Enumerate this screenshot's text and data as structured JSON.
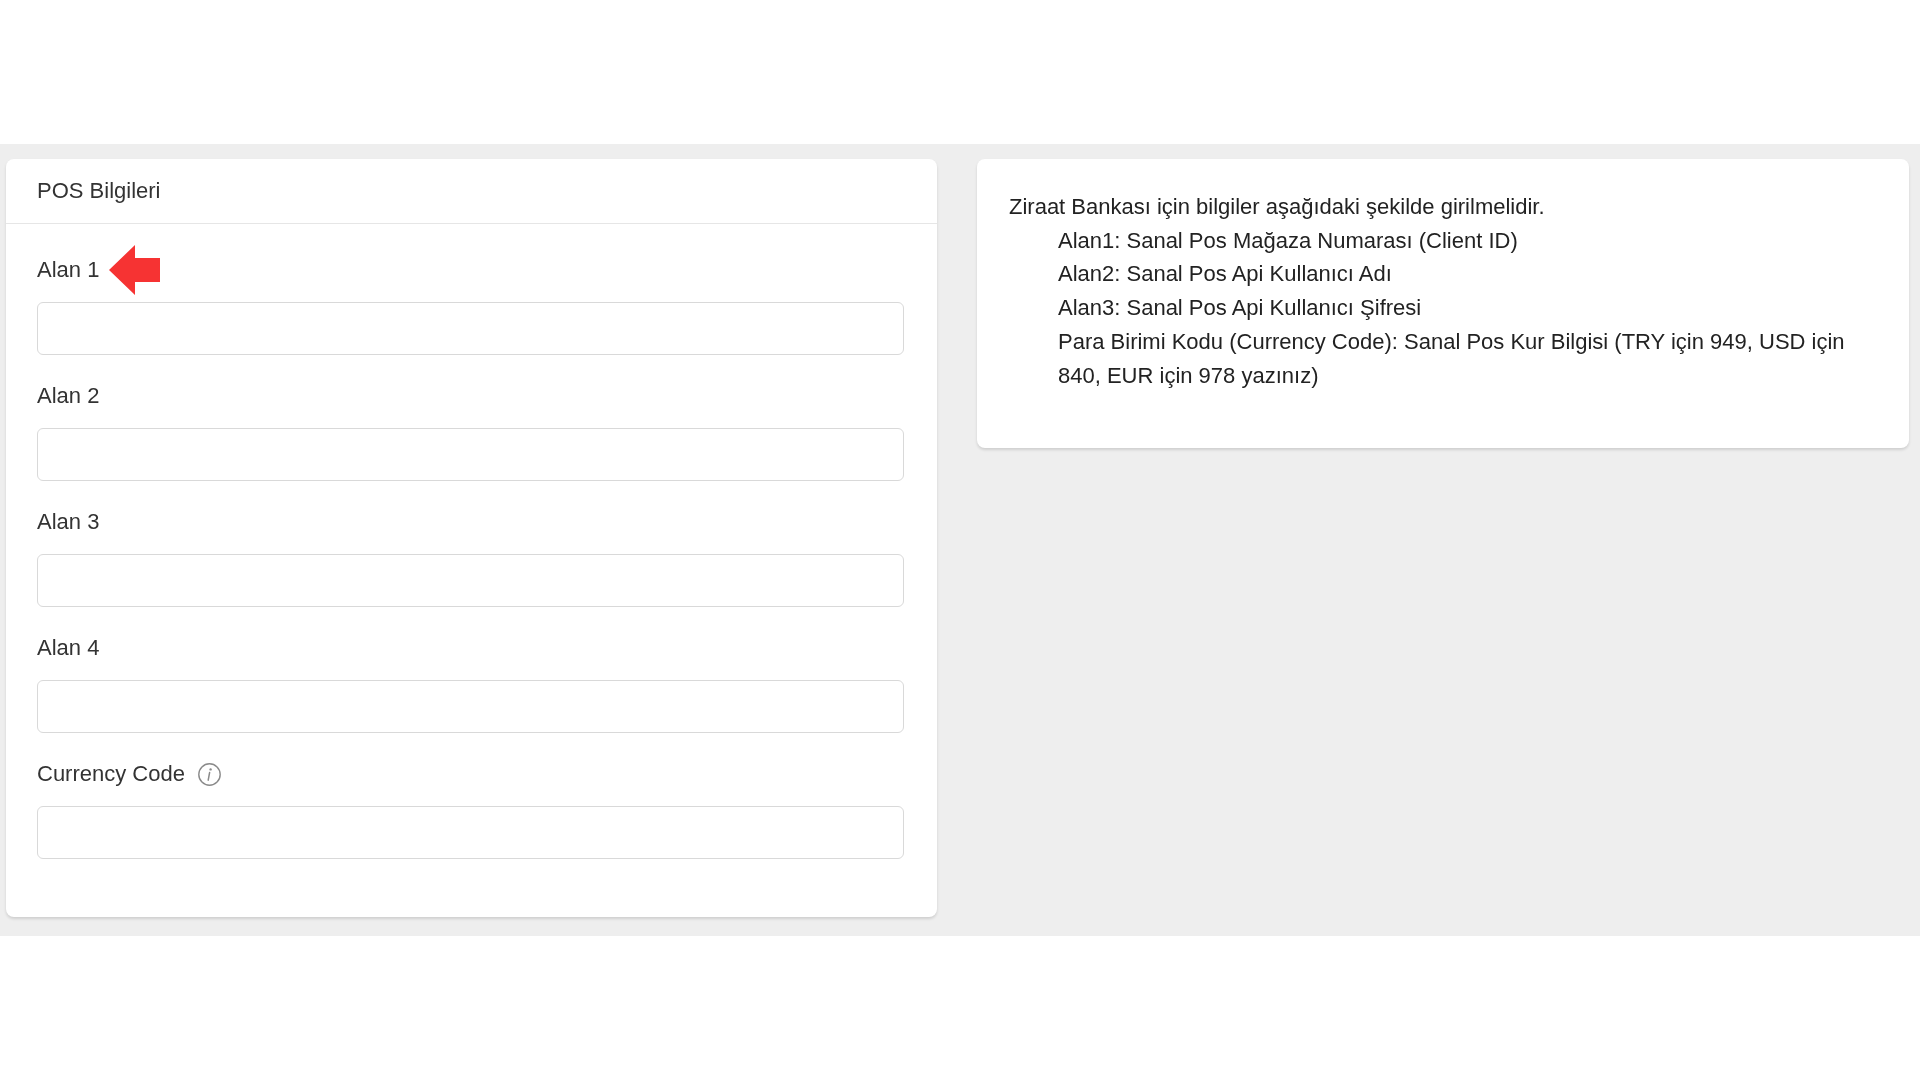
{
  "pos_card": {
    "title": "POS Bilgileri",
    "fields": [
      {
        "label": "Alan 1",
        "arrow": true,
        "info": false
      },
      {
        "label": "Alan 2",
        "arrow": false,
        "info": false
      },
      {
        "label": "Alan 3",
        "arrow": false,
        "info": false
      },
      {
        "label": "Alan 4",
        "arrow": false,
        "info": false
      },
      {
        "label": "Currency Code",
        "arrow": false,
        "info": true
      }
    ]
  },
  "info_card": {
    "intro": "Ziraat Bankası için bilgiler aşağıdaki şekilde girilmelidir.",
    "items": [
      "Alan1: Sanal Pos Mağaza Numarası (Client ID)",
      "Alan2: Sanal Pos Api Kullanıcı Adı",
      "Alan3: Sanal Pos Api Kullanıcı Şifresi",
      "Para Birimi Kodu (Currency Code): Sanal Pos Kur Bilgisi (TRY için 949, USD için 840, EUR için 978 yazınız)"
    ]
  }
}
